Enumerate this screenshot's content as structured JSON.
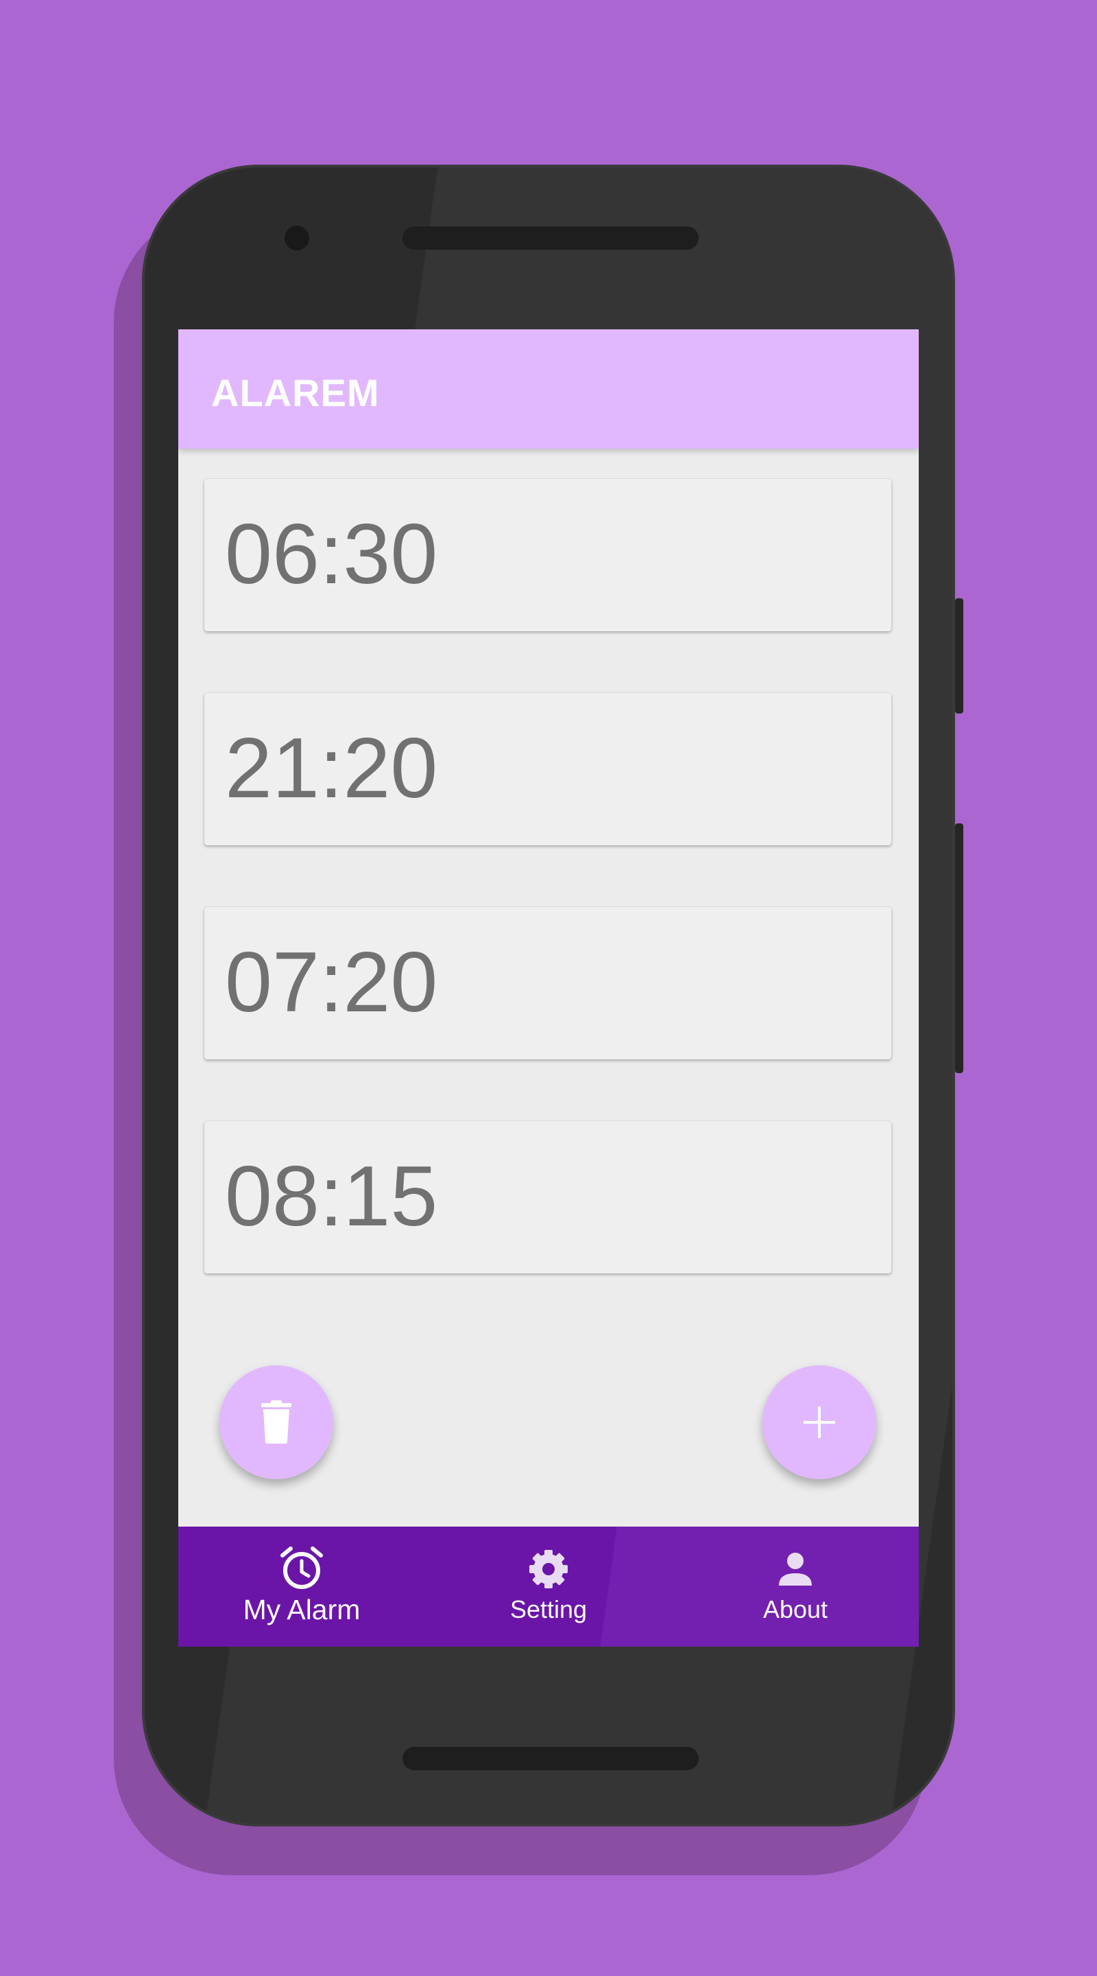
{
  "app_bar": {
    "title": "ALAREM"
  },
  "alarms": [
    {
      "time": "06:30"
    },
    {
      "time": "21:20"
    },
    {
      "time": "07:20"
    },
    {
      "time": "08:15"
    }
  ],
  "fabs": {
    "delete_icon": "trash-icon",
    "add_icon": "plus-icon"
  },
  "bottom_nav": {
    "items": [
      {
        "label": "My Alarm",
        "icon": "alarm-clock-icon",
        "active": true
      },
      {
        "label": "Setting",
        "icon": "gear-icon",
        "active": false
      },
      {
        "label": "About",
        "icon": "person-icon",
        "active": false
      }
    ]
  },
  "colors": {
    "background": "#ab66d1",
    "app_bar": "#e1b8fe",
    "bottom_nav": "#6a15a8",
    "fab": "#e1b8fe",
    "card": "#efefef",
    "time_text": "#717171"
  }
}
